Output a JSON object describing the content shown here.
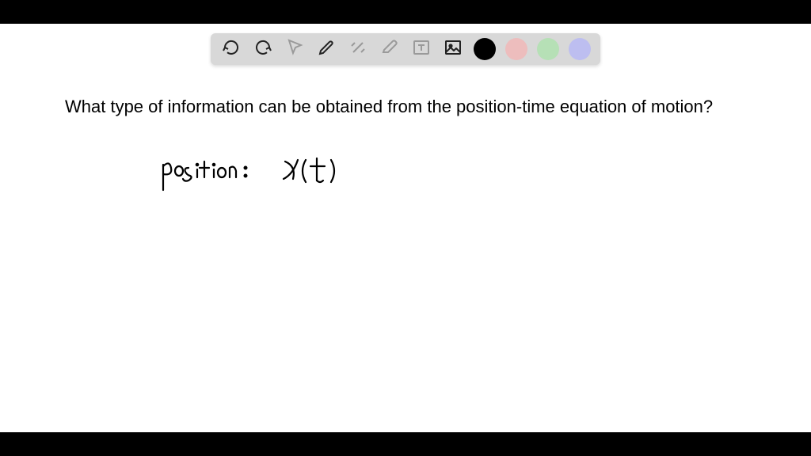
{
  "question_text": "What type of information can be obtained from the position-time equation of motion?",
  "handwritten": {
    "label": "position:",
    "expression": "x(t)"
  },
  "toolbar": {
    "undo": "undo-icon",
    "redo": "redo-icon",
    "pointer": "pointer-icon",
    "pen": "pen-icon",
    "tools": "tools-icon",
    "eraser": "eraser-icon",
    "text": "text-icon",
    "image": "image-icon",
    "colors": {
      "black": "#000000",
      "pink": "#edbdbd",
      "green": "#b6e0b6",
      "purple": "#bdbef0"
    }
  }
}
